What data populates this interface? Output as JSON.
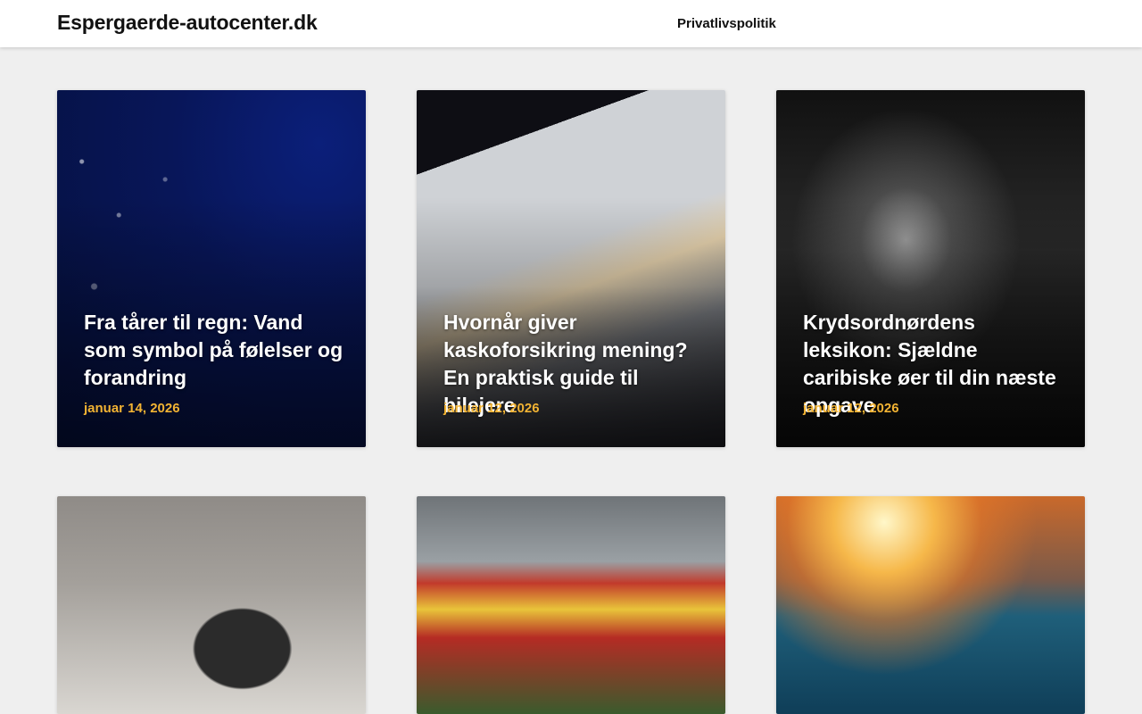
{
  "header": {
    "site_title": "Espergaerde-autocenter.dk",
    "nav": [
      {
        "label": "Privatlivspolitik"
      }
    ]
  },
  "posts": [
    {
      "title": "Fra tårer til regn: Vand som symbol på følelser og forandring",
      "date": "januar 14, 2026",
      "image": "rain-drops-on-blue-background"
    },
    {
      "title": "Hvornår giver kaskoforsikring mening? En praktisk guide til bilejere",
      "date": "januar 12, 2026",
      "image": "view-through-car-window-at-sunset"
    },
    {
      "title": "Krydsordnørdens leksikon: Sjældne caribiske øer til din næste opgave",
      "date": "januar 12, 2026",
      "image": "lighthouse-black-and-white"
    },
    {
      "title": "",
      "date": "",
      "image": "woman-with-glasses-at-desk"
    },
    {
      "title": "",
      "date": "",
      "image": "fair-food-stands-corn-dogs"
    },
    {
      "title": "",
      "date": "",
      "image": "swimmer-at-sunset-pool"
    }
  ],
  "colors": {
    "page_background": "#efefef",
    "header_background": "#ffffff",
    "title_text": "#ffffff",
    "date_accent": "#f2b333"
  }
}
